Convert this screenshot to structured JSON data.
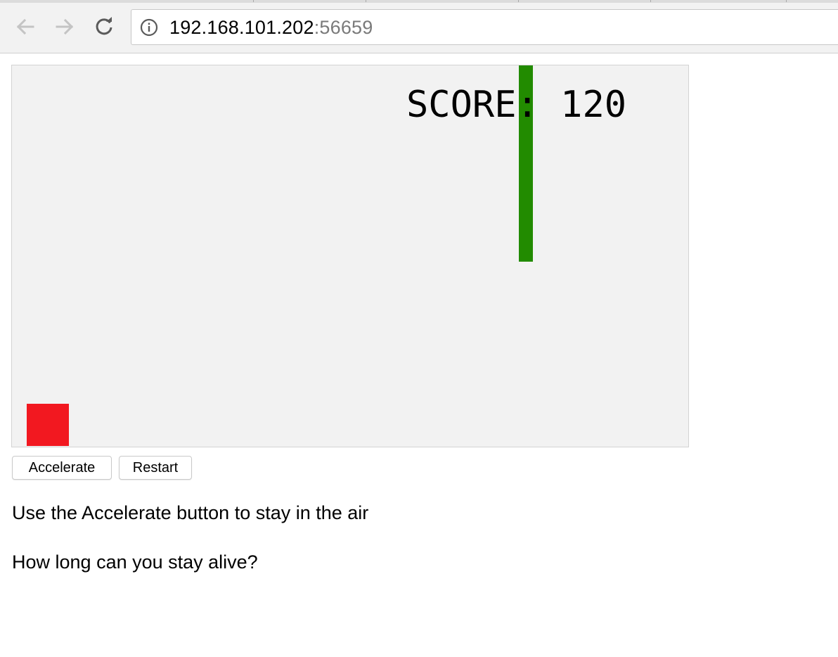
{
  "browser": {
    "url_host": "192.168.101.202",
    "url_port": ":56659",
    "icons": {
      "back": "arrow-left-icon",
      "forward": "arrow-right-icon",
      "reload": "reload-icon",
      "site_info": "info-icon"
    }
  },
  "game": {
    "score_label": "SCORE: 120",
    "score": 120,
    "colors": {
      "background": "#f2f2f2",
      "obstacle": "#228b00",
      "player": "#f21820",
      "score_text": "#000000"
    }
  },
  "controls": {
    "accelerate_label": "Accelerate",
    "restart_label": "Restart"
  },
  "instructions": {
    "line1": "Use the Accelerate button to stay in the air",
    "line2": "How long can you stay alive?"
  }
}
